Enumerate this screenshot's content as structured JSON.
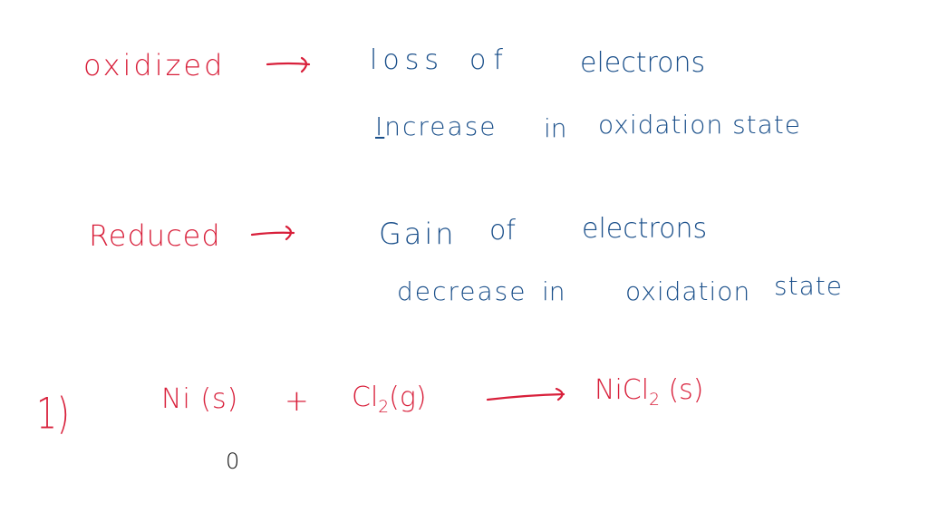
{
  "colors": {
    "red_ink": "#d81f3a",
    "blue_ink": "#1a4f8a",
    "black_ink": "#111111",
    "background": "#ffffff"
  },
  "oxidized": {
    "term": "oxidized",
    "arrow_icon": "right-arrow",
    "definition_1_words": [
      "loss",
      "of",
      "electrons"
    ],
    "definition_2_words": [
      "Increase",
      "in",
      "oxidation state"
    ]
  },
  "reduced": {
    "term": "Reduced",
    "arrow_icon": "right-arrow",
    "definition_1_words": [
      "Gain",
      "of",
      "electrons"
    ],
    "definition_2_words": [
      "decrease",
      "in",
      "oxidation",
      "state"
    ]
  },
  "equation": {
    "number": "1)",
    "reactant_1": "Ni (s)",
    "plus": "+",
    "reactant_2_symbol": "Cl",
    "reactant_2_subscript": "2",
    "reactant_2_state": "(g)",
    "arrow_icon": "reaction-arrow",
    "product_symbol": "NiCl",
    "product_subscript": "2",
    "product_state": "(s)",
    "annotation": "0"
  }
}
